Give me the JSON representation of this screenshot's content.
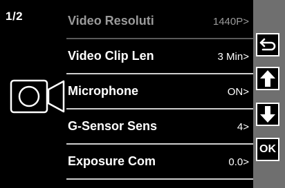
{
  "page_indicator": "1/2",
  "mode_icon": "video-camera-icon",
  "menu": {
    "items": [
      {
        "label": "Video Resoluti",
        "value": "1440P>",
        "state": "dimmed"
      },
      {
        "label": "Video Clip Len",
        "value": "3 Min>",
        "state": "normal"
      },
      {
        "label": "Microphone",
        "value": "ON>",
        "state": "normal"
      },
      {
        "label": "G-Sensor Sens",
        "value": "4>",
        "state": "normal"
      },
      {
        "label": "Exposure Com",
        "value": "0.0>",
        "state": "normal"
      }
    ]
  },
  "side_panel": {
    "buttons": [
      {
        "name": "back-button",
        "icon": "return-arrow-icon"
      },
      {
        "name": "up-button",
        "icon": "arrow-up-icon"
      },
      {
        "name": "down-button",
        "icon": "arrow-down-icon"
      },
      {
        "name": "ok-button",
        "label": "OK"
      }
    ]
  },
  "colors": {
    "background": "#000000",
    "text": "#ffffff",
    "dimmed_text": "#9a9a9a",
    "side_panel": "#6f6f6f",
    "divider": "#cfcfcf"
  }
}
